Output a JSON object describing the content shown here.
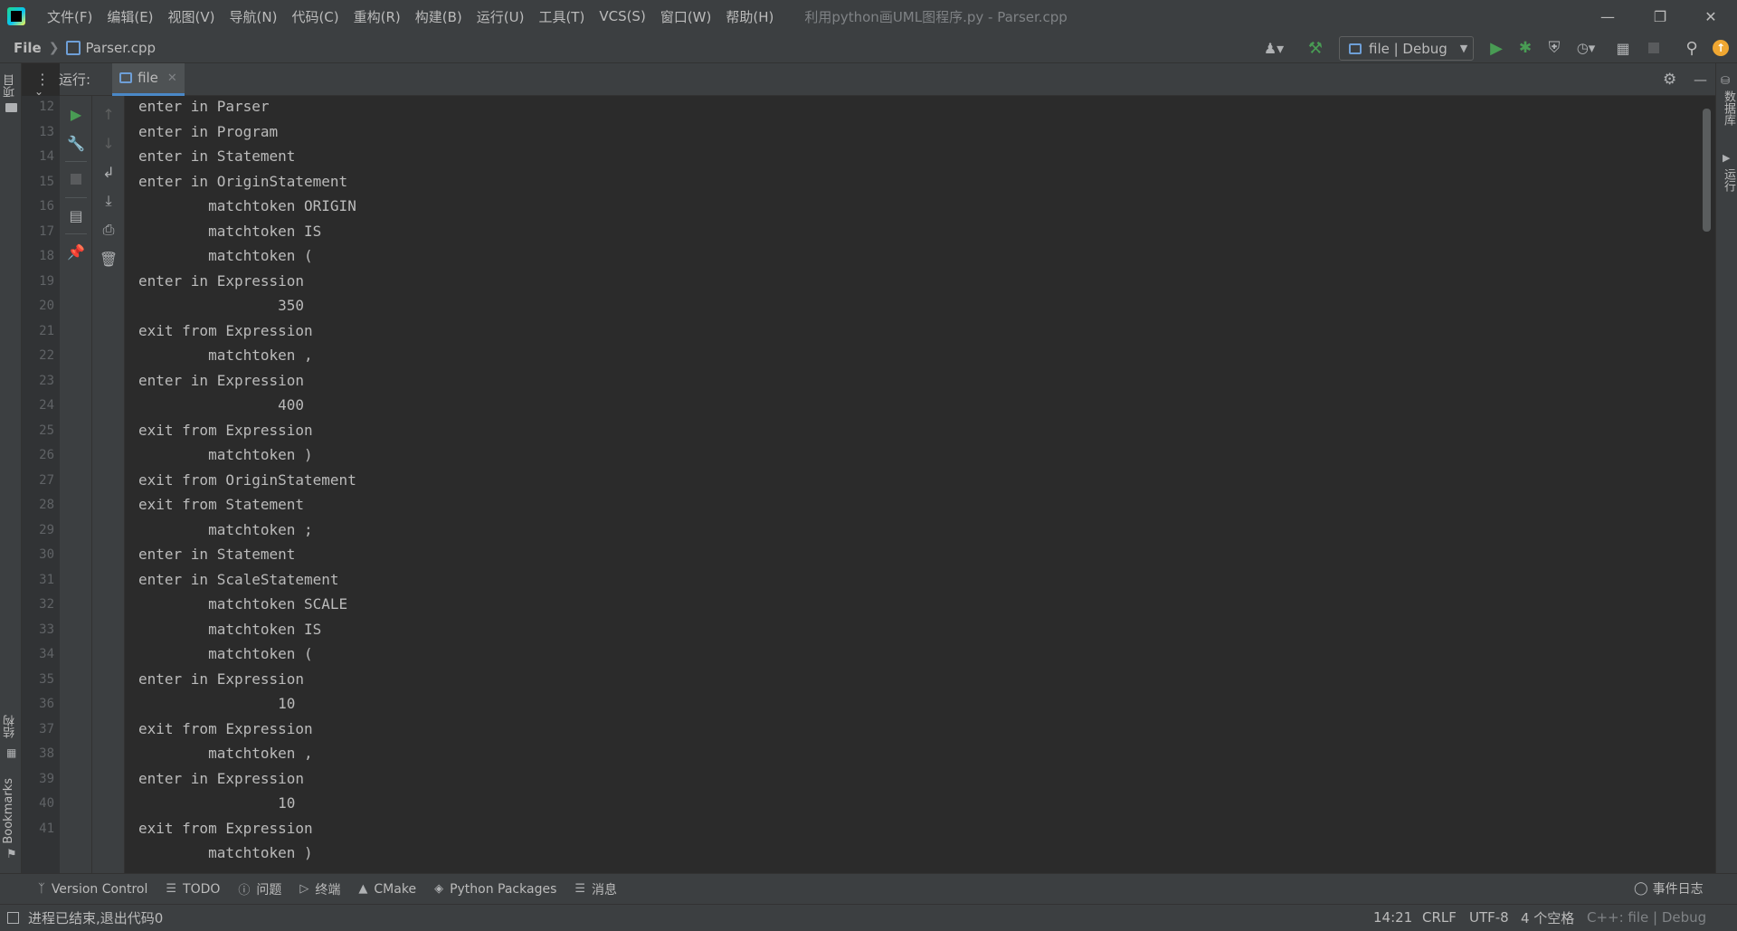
{
  "window": {
    "title": "利用python画UML图程序.py - Parser.cpp",
    "menu": [
      "文件(F)",
      "编辑(E)",
      "视图(V)",
      "导航(N)",
      "代码(C)",
      "重构(R)",
      "构建(B)",
      "运行(U)",
      "工具(T)",
      "VCS(S)",
      "窗口(W)",
      "帮助(H)"
    ]
  },
  "navbar": {
    "project": "File",
    "file": "Parser.cpp",
    "run_config": "file | Debug"
  },
  "left_stripe": {
    "project_tab": "项目",
    "structure_tab": "结构",
    "bookmarks_tab": "Bookmarks"
  },
  "right_stripe": {
    "database_tab": "数据库",
    "run_tab": "运行"
  },
  "run_panel": {
    "label": "运行:",
    "tab": "file"
  },
  "gutter": {
    "line_numbers": [
      "12",
      "13",
      "14",
      "15",
      "16",
      "17",
      "18",
      "19",
      "20",
      "21",
      "22",
      "23",
      "24",
      "25",
      "26",
      "27",
      "28",
      "29",
      "30",
      "31",
      "32",
      "33",
      "34",
      "35",
      "36",
      "37",
      "38",
      "39",
      "40",
      "41"
    ]
  },
  "console": {
    "lines": [
      "enter in Parser",
      "enter in Program",
      "enter in Statement",
      "enter in OriginStatement",
      "        matchtoken ORIGIN",
      "        matchtoken IS",
      "        matchtoken (",
      "enter in Expression",
      "                350",
      "exit from Expression",
      "        matchtoken ,",
      "enter in Expression",
      "                400",
      "exit from Expression",
      "        matchtoken )",
      "exit from OriginStatement",
      "exit from Statement",
      "        matchtoken ;",
      "enter in Statement",
      "enter in ScaleStatement",
      "        matchtoken SCALE",
      "        matchtoken IS",
      "        matchtoken (",
      "enter in Expression",
      "                10",
      "exit from Expression",
      "        matchtoken ,",
      "enter in Expression",
      "                10",
      "exit from Expression",
      "        matchtoken )"
    ]
  },
  "tool_tabs": {
    "version_control": "Version Control",
    "todo": "TODO",
    "problems": "问题",
    "terminal": "终端",
    "cmake": "CMake",
    "python_packages": "Python Packages",
    "messages": "消息",
    "event_log": "事件日志"
  },
  "status": {
    "message": "进程已结束,退出代码0",
    "position": "14:21",
    "line_sep": "CRLF",
    "encoding": "UTF-8",
    "indent": "4 个空格",
    "context": "C++: file | Debug"
  },
  "colors": {
    "accent_green": "#499c54",
    "accent_blue": "#4a88c7",
    "update_orange": "#f0a732"
  }
}
